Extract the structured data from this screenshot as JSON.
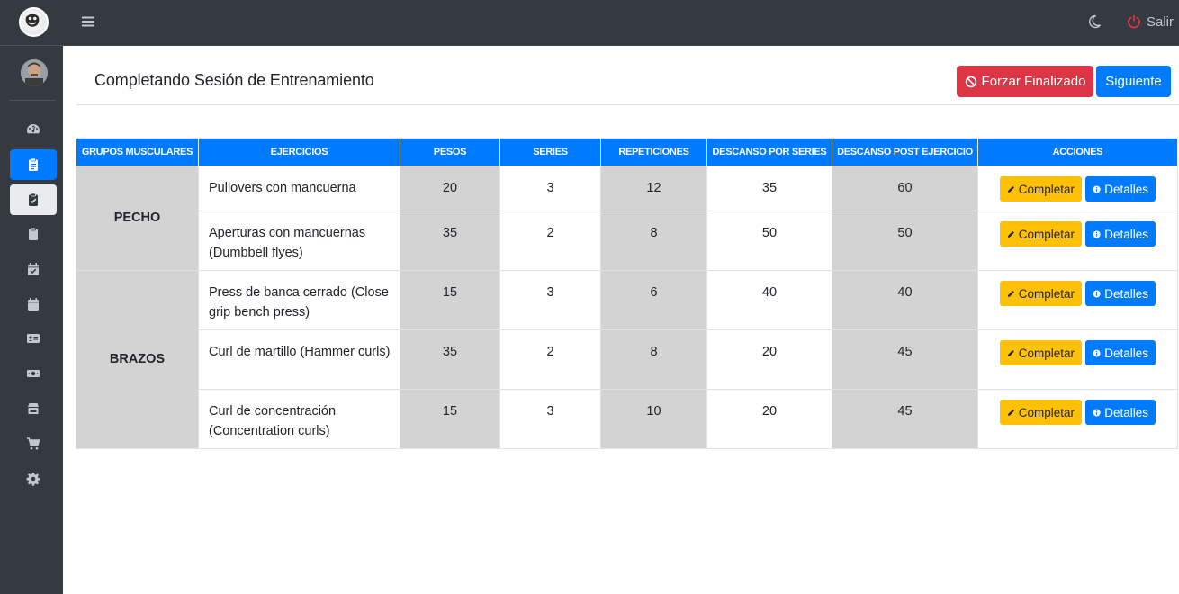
{
  "topbar": {
    "logout_label": "Salir"
  },
  "header": {
    "title": "Completando Sesión de Entrenamiento",
    "force_button": "Forzar Finalizado",
    "next_button": "Siguiente"
  },
  "table": {
    "columns": [
      "GRUPOS MUSCULARES",
      "EJERCICIOS",
      "PESOS",
      "SERIES",
      "REPETICIONES",
      "DESCANSO POR SERIES",
      "DESCANSO POST EJERCICIO",
      "ACCIONES"
    ],
    "groups": [
      {
        "name": "PECHO",
        "rows": [
          {
            "exercise": "Pullovers con mancuerna",
            "weight": "20",
            "series": "3",
            "reps": "12",
            "rest_series": "35",
            "rest_post": "60"
          },
          {
            "exercise": "Aperturas con mancuernas (Dumbbell flyes)",
            "weight": "35",
            "series": "2",
            "reps": "8",
            "rest_series": "50",
            "rest_post": "50"
          }
        ]
      },
      {
        "name": "BRAZOS",
        "rows": [
          {
            "exercise": "Press de banca cerrado (Close grip bench press)",
            "weight": "15",
            "series": "3",
            "reps": "6",
            "rest_series": "40",
            "rest_post": "40"
          },
          {
            "exercise": "Curl de martillo (Hammer curls)",
            "weight": "35",
            "series": "2",
            "reps": "8",
            "rest_series": "20",
            "rest_post": "45"
          },
          {
            "exercise": "Curl de concentración (Concentration curls)",
            "weight": "15",
            "series": "3",
            "reps": "10",
            "rest_series": "20",
            "rest_post": "45"
          }
        ]
      }
    ],
    "complete_label": "Completar",
    "details_label": "Detalles"
  },
  "colors": {
    "sidebar": "#343a40",
    "primary": "#007bff",
    "danger": "#dc3545",
    "warning": "#ffc107",
    "gray_cell": "#d3d3d3"
  },
  "icons": {
    "sidebar": [
      "tachometer-icon",
      "clipboard-icon",
      "clipboard-check-icon",
      "clipboard-icon",
      "calendar-check-icon",
      "calendar-icon",
      "id-card-icon",
      "money-bill-icon",
      "store-icon",
      "shopping-cart-icon",
      "cog-icon"
    ]
  }
}
